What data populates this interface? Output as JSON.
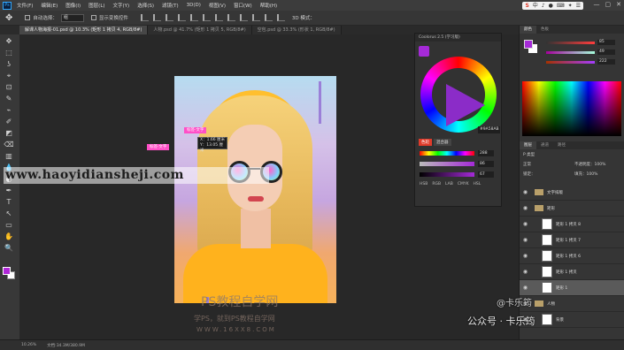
{
  "app": {
    "logo_text": "Ps"
  },
  "menu": {
    "items": [
      "文件(F)",
      "编辑(E)",
      "图像(I)",
      "图层(L)",
      "文字(Y)",
      "选择(S)",
      "滤镜(T)",
      "3D(D)",
      "视图(V)",
      "窗口(W)",
      "帮助(H)"
    ]
  },
  "tray": {
    "brand": "S",
    "items": [
      "中",
      "♪",
      "●",
      "⌨",
      "✦",
      "☰"
    ]
  },
  "window_controls": [
    "—",
    "▢",
    "✕"
  ],
  "options": {
    "auto_select_label": "自动选择：",
    "auto_select_value": "组",
    "transform_label": "显示变换控件",
    "mode_label": "3D 模式："
  },
  "tabs": [
    {
      "label": "解课人物海报-01.psd @ 10.3% (矩形 1 拷贝 4, RGB/8#)",
      "active": true
    },
    {
      "label": "人物.psd @ 41.7% (矩形 1 拷贝 5, RGB/8#)",
      "active": false
    },
    {
      "label": "空包.psd @ 33.3% (形状 1, RGB/8#)",
      "active": false
    }
  ],
  "tools": [
    "✥",
    "⬚",
    "ʖ",
    "⌖",
    "⊡",
    "✎",
    "⌁",
    "✐",
    "◩",
    "⌫",
    "▥",
    "💧",
    "◐",
    "✒",
    "T",
    "↖",
    "▭",
    "✋",
    "🔍"
  ],
  "canvas": {
    "tag_1": "标签·文字",
    "tag_2": "标签·文字",
    "tooltip_line_1": "X：1.66 厘米",
    "tooltip_line_2": "Y：13.05 厘米",
    "site_watermark": "www.haoyidiansheji.com",
    "wm_line_1": "PS教程自学网",
    "wm_line_2": "学PS，就到PS教程自学网",
    "wm_line_3": "WWW.16XX8.COM"
  },
  "wheel_panel": {
    "title": "Coolorus 2.5 (学习版)",
    "hex": "#9A58AB",
    "tabs": [
      "色轮",
      "混合器"
    ],
    "sliders": [
      {
        "value": "288",
        "gradient": "linear-gradient(90deg,#f00,#ff0,#0f0,#0ff,#00f,#f0f,#f00)"
      },
      {
        "value": "86",
        "gradient": "linear-gradient(90deg,#bbb,#a52ad8)"
      },
      {
        "value": "67",
        "gradient": "linear-gradient(90deg,#000,#a52ad8)"
      }
    ],
    "modes": [
      "HSB",
      "RGB",
      "LAB",
      "CMYK",
      "HSL"
    ]
  },
  "color_panel": {
    "tabs": [
      "颜色",
      "色板"
    ],
    "values": [
      "85",
      "49",
      "222"
    ],
    "slider_gradients": [
      "linear-gradient(90deg,#333,#ff3d3d)",
      "linear-gradient(90deg,#a5009b,#a5ffdb)",
      "linear-gradient(90deg,#a53100,#a53dff)"
    ]
  },
  "layers_panel": {
    "tabs": [
      "图层",
      "通道",
      "路径"
    ],
    "filter_label": "P 类型",
    "blend_mode": "正常",
    "opacity_label": "不透明度：100%",
    "lock_label": "锁定：",
    "fill_label": "填充：100%",
    "layers": [
      {
        "name": "文字排版",
        "kind": "folder",
        "selected": false
      },
      {
        "name": "矩形",
        "kind": "folder",
        "selected": false
      },
      {
        "name": "矩形 1 拷贝 8",
        "kind": "layer",
        "selected": false
      },
      {
        "name": "矩形 1 拷贝 7",
        "kind": "layer",
        "selected": false
      },
      {
        "name": "矩形 1 拷贝 6",
        "kind": "layer",
        "selected": false
      },
      {
        "name": "矩形 1 拷贝",
        "kind": "layer",
        "selected": false
      },
      {
        "name": "矩形 1",
        "kind": "layer",
        "selected": true
      },
      {
        "name": "人物",
        "kind": "folder",
        "selected": false
      },
      {
        "name": "背景",
        "kind": "layer",
        "selected": false
      }
    ]
  },
  "overlay": {
    "line_1": "@卡乐筠",
    "line_2": "公众号 · 卡乐筠"
  },
  "status": {
    "zoom": "10.26%",
    "doc_info": "文档:34.3M/380.9M"
  }
}
